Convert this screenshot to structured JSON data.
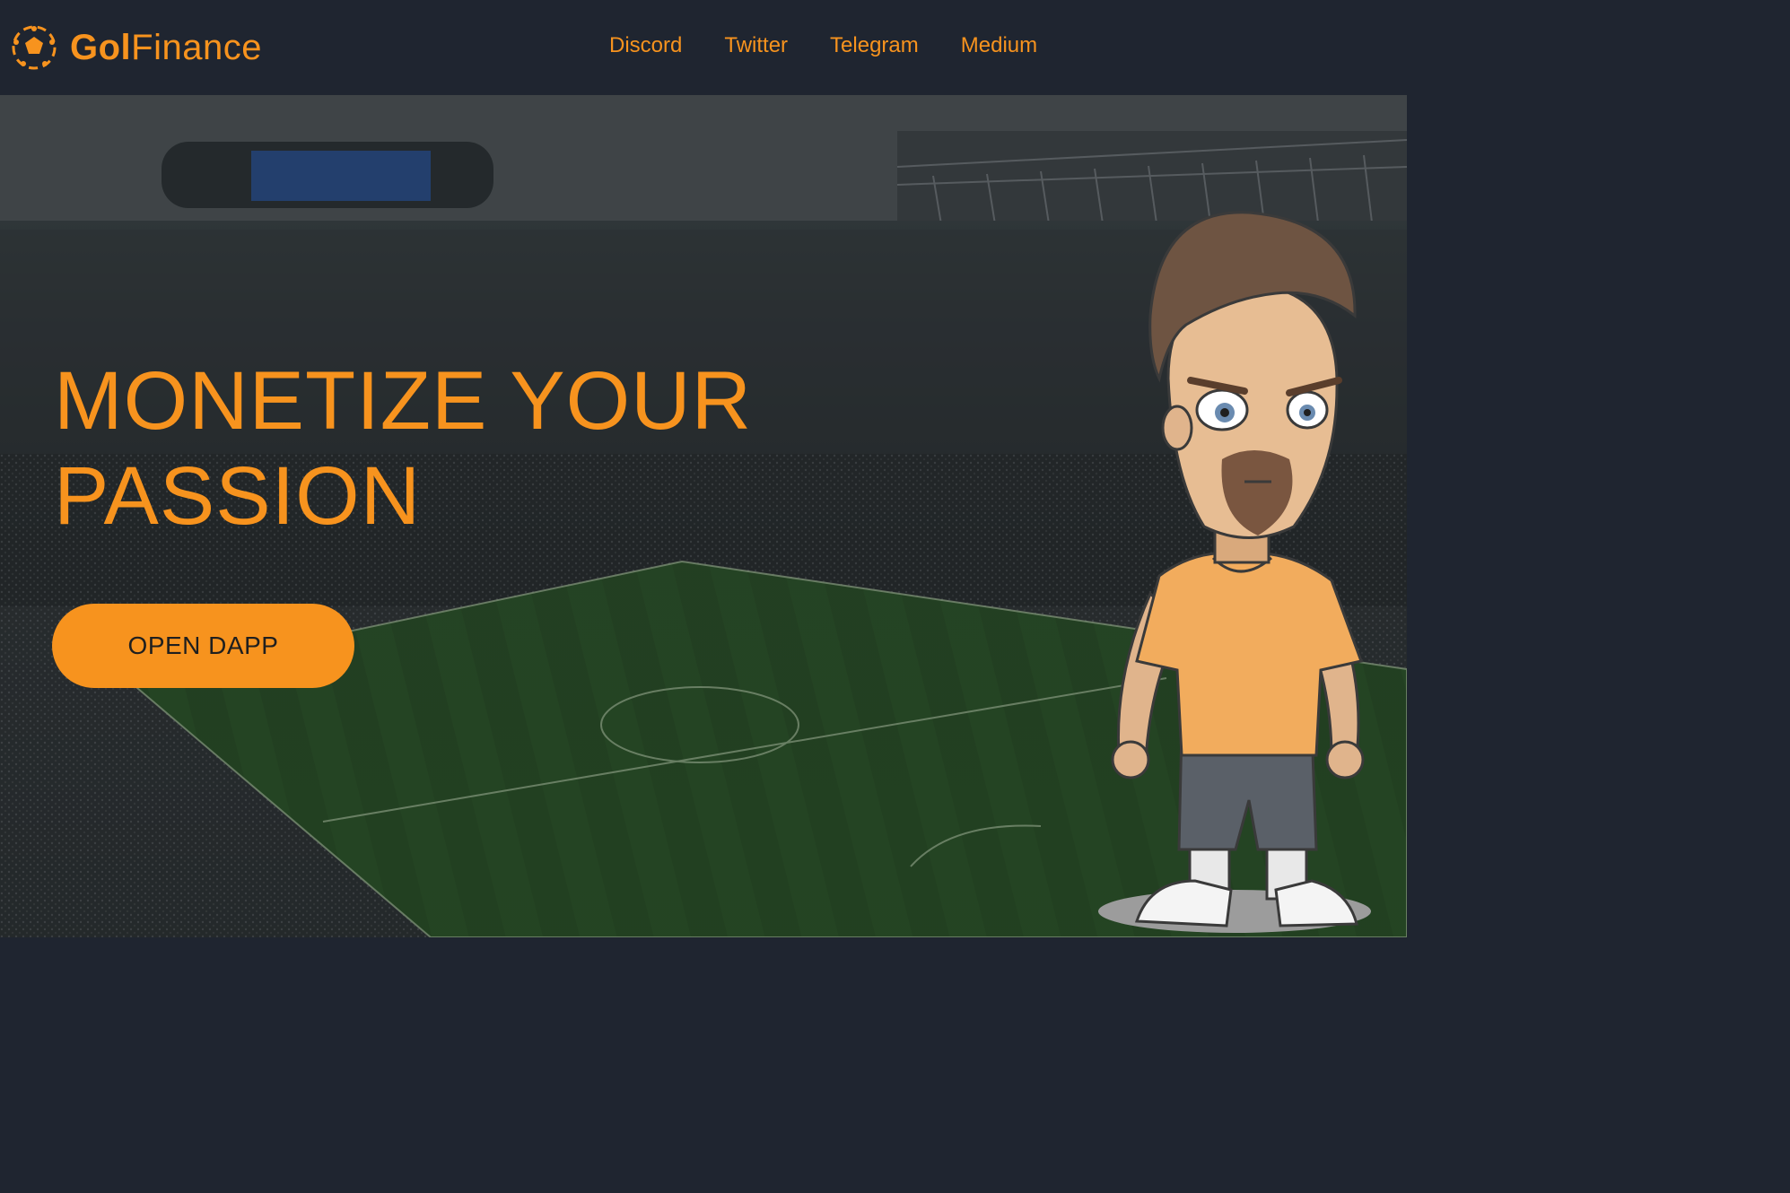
{
  "brand": {
    "name_part1": "Gol",
    "name_part2": "Finance",
    "logo_icon": "soccer-ball-icon"
  },
  "nav": {
    "links": [
      {
        "label": "Discord"
      },
      {
        "label": "Twitter"
      },
      {
        "label": "Telegram"
      },
      {
        "label": "Medium"
      }
    ]
  },
  "hero": {
    "title_line1": "MONETIZE YOUR",
    "title_line2": "PASSION",
    "cta_label": "OPEN DAPP",
    "background": "stadium-photo",
    "mascot": "cartoon-footballer-mascot"
  },
  "colors": {
    "accent": "#f7931e",
    "navbar_bg": "#1f2530",
    "pitch_green": "#2f5a2c"
  }
}
